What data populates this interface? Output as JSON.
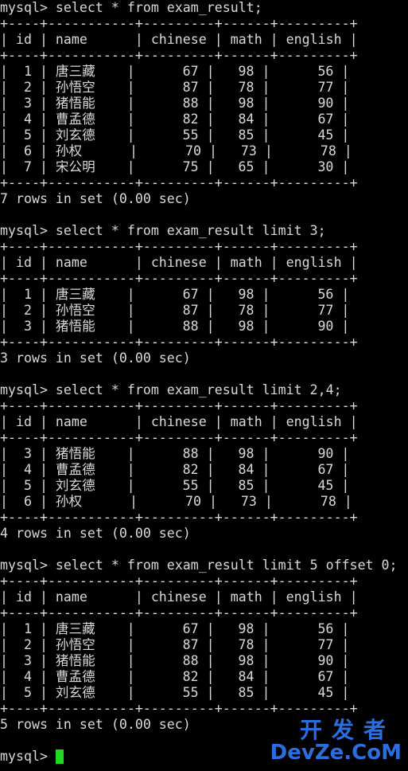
{
  "terminal": {
    "lines": [
      "mysql> select * from exam_result;",
      "+----+-----------+---------+------+---------+",
      "| id | name      | chinese | math | english |",
      "+----+-----------+---------+------+---------+",
      "|  1 | 唐三藏    |      67 |   98 |      56 |",
      "|  2 | 孙悟空    |      87 |   78 |      77 |",
      "|  3 | 猪悟能    |      88 |   98 |      90 |",
      "|  4 | 曹孟德    |      82 |   84 |      67 |",
      "|  5 | 刘玄德    |      55 |   85 |      45 |",
      "|  6 | 孙权      |      70 |   73 |      78 |",
      "|  7 | 宋公明    |      75 |   65 |      30 |",
      "+----+-----------+---------+------+---------+",
      "7 rows in set (0.00 sec)",
      "",
      "mysql> select * from exam_result limit 3;",
      "+----+-----------+---------+------+---------+",
      "| id | name      | chinese | math | english |",
      "+----+-----------+---------+------+---------+",
      "|  1 | 唐三藏    |      67 |   98 |      56 |",
      "|  2 | 孙悟空    |      87 |   78 |      77 |",
      "|  3 | 猪悟能    |      88 |   98 |      90 |",
      "+----+-----------+---------+------+---------+",
      "3 rows in set (0.00 sec)",
      "",
      "mysql> select * from exam_result limit 2,4;",
      "+----+-----------+---------+------+---------+",
      "| id | name      | chinese | math | english |",
      "+----+-----------+---------+------+---------+",
      "|  3 | 猪悟能    |      88 |   98 |      90 |",
      "|  4 | 曹孟德    |      82 |   84 |      67 |",
      "|  5 | 刘玄德    |      55 |   85 |      45 |",
      "|  6 | 孙权      |      70 |   73 |      78 |",
      "+----+-----------+---------+------+---------+",
      "4 rows in set (0.00 sec)",
      "",
      "mysql> select * from exam_result limit 5 offset 0;",
      "+----+-----------+---------+------+---------+",
      "| id | name      | chinese | math | english |",
      "+----+-----------+---------+------+---------+",
      "|  1 | 唐三藏    |      67 |   98 |      56 |",
      "|  2 | 孙悟空    |      87 |   78 |      77 |",
      "|  3 | 猪悟能    |      88 |   98 |      90 |",
      "|  4 | 曹孟德    |      82 |   84 |      67 |",
      "|  5 | 刘玄德    |      55 |   85 |      45 |",
      "+----+-----------+---------+------+---------+",
      "5 rows in set (0.00 sec)",
      ""
    ],
    "prompt": "mysql> ",
    "cursor_color": "#20d820"
  },
  "watermark": {
    "cn_text": "开发者",
    "en_text": "DevZe.CoM",
    "color": "#2a6fe0"
  }
}
